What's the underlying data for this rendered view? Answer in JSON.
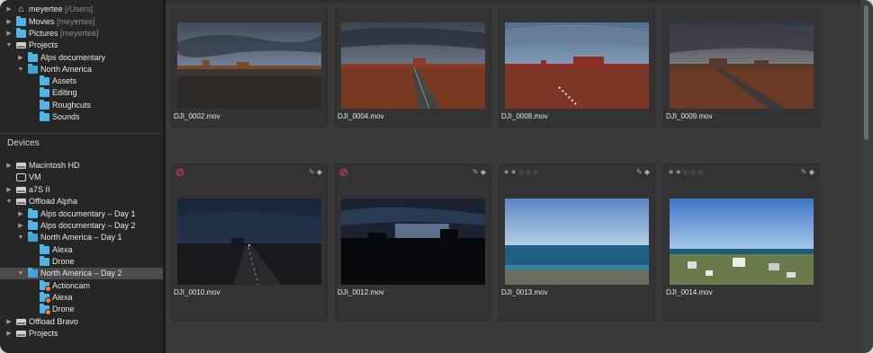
{
  "sidebar": {
    "places": [
      {
        "label": "meyertee",
        "sub": "[/Users]",
        "icon": "home-icon"
      },
      {
        "label": "Movies",
        "sub": "[meyertee]",
        "icon": "folder-icon"
      },
      {
        "label": "Pictures",
        "sub": "[meyertee]",
        "icon": "folder-icon"
      },
      {
        "label": "Projects",
        "sub": "",
        "icon": "drive-icon"
      },
      {
        "label": "Alps documentary",
        "sub": "",
        "icon": "folder-icon"
      },
      {
        "label": "North America",
        "sub": "",
        "icon": "folder-open-icon"
      },
      {
        "label": "Assets",
        "sub": "",
        "icon": "folder-icon"
      },
      {
        "label": "Editing",
        "sub": "",
        "icon": "folder-icon"
      },
      {
        "label": "Roughcuts",
        "sub": "",
        "icon": "folder-icon"
      },
      {
        "label": "Sounds",
        "sub": "",
        "icon": "folder-icon"
      }
    ],
    "devices_title": "Devices",
    "devices": [
      {
        "label": "Macintosh HD",
        "icon": "drive-icon"
      },
      {
        "label": "VM",
        "icon": "monitor-icon"
      },
      {
        "label": "a7S II",
        "icon": "drive-icon"
      },
      {
        "label": "Offload Alpha",
        "icon": "drive-icon"
      },
      {
        "label": "Alps documentary – Day 1",
        "icon": "folder-icon"
      },
      {
        "label": "Alps documentary – Day 2",
        "icon": "folder-icon"
      },
      {
        "label": "North America – Day 1",
        "icon": "folder-open-icon"
      },
      {
        "label": "Alexa",
        "icon": "folder-icon"
      },
      {
        "label": "Drone",
        "icon": "folder-icon"
      },
      {
        "label": "North America – Day 2",
        "icon": "folder-open-icon"
      },
      {
        "label": "Actioncam",
        "icon": "folder-badge-icon"
      },
      {
        "label": "Alexa",
        "icon": "folder-badge-icon"
      },
      {
        "label": "Drone",
        "icon": "folder-badge-icon"
      },
      {
        "label": "Offload Bravo",
        "icon": "drive-icon"
      },
      {
        "label": "Projects",
        "icon": "drive-icon"
      }
    ]
  },
  "clips": [
    {
      "name": "DJI_0002.mov",
      "rating": "",
      "rejected": false,
      "scene": "desert-dusk"
    },
    {
      "name": "DJI_0004.mov",
      "rating": "",
      "rejected": false,
      "scene": "desert-road"
    },
    {
      "name": "DJI_0008.mov",
      "rating": "",
      "rejected": false,
      "scene": "desert-plain"
    },
    {
      "name": "DJI_0009.mov",
      "rating": "",
      "rejected": false,
      "scene": "desert-sunset"
    },
    {
      "name": "DJI_0010.mov",
      "rating": "",
      "rejected": true,
      "scene": "night-road"
    },
    {
      "name": "DJI_0012.mov",
      "rating": "",
      "rejected": true,
      "scene": "night-mesa"
    },
    {
      "name": "DJI_0013.mov",
      "rating": "★★☆☆☆",
      "rejected": false,
      "scene": "ocean-shore"
    },
    {
      "name": "DJI_0014.mov",
      "rating": "★★☆☆☆",
      "rejected": false,
      "scene": "coastal-town"
    }
  ],
  "card_tools": "✎ ◆",
  "colors": {
    "folder": "#4fb5e6",
    "reject": "#dd4444",
    "badge": "#ff7a2a"
  }
}
